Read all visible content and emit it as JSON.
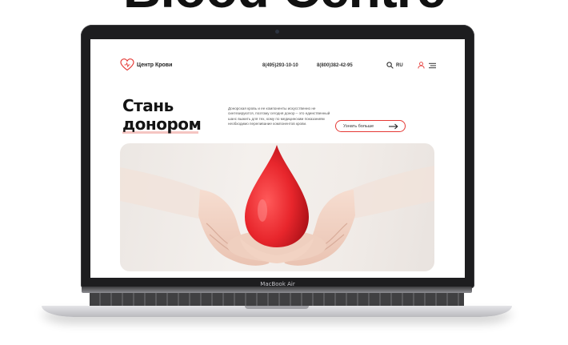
{
  "top_heading": "Blood Centre",
  "device": {
    "label": "MacBook Air"
  },
  "site": {
    "logo_text": "Центр Крови",
    "phones": [
      "8(495)293-10-10",
      "8(800)382-42-95"
    ],
    "language": "RU",
    "icons": [
      "heart-icon",
      "search-icon",
      "user-icon",
      "menu-icon",
      "arrow-right-icon",
      "blood-drop-icon"
    ],
    "hero": {
      "title_line1": "Стань",
      "title_line2": "донором",
      "description": "Донорская кровь и ее компоненты искусственно не синтезируются, поэтому сегодня донор – это единственный шанс выжить для тех, кому по медицинским показаниям необходимо переливание компонентов крови.",
      "button_label": "Узнать больше"
    },
    "colors": {
      "accent": "#e53935",
      "drop": "#e8262c",
      "text": "#141414"
    }
  }
}
